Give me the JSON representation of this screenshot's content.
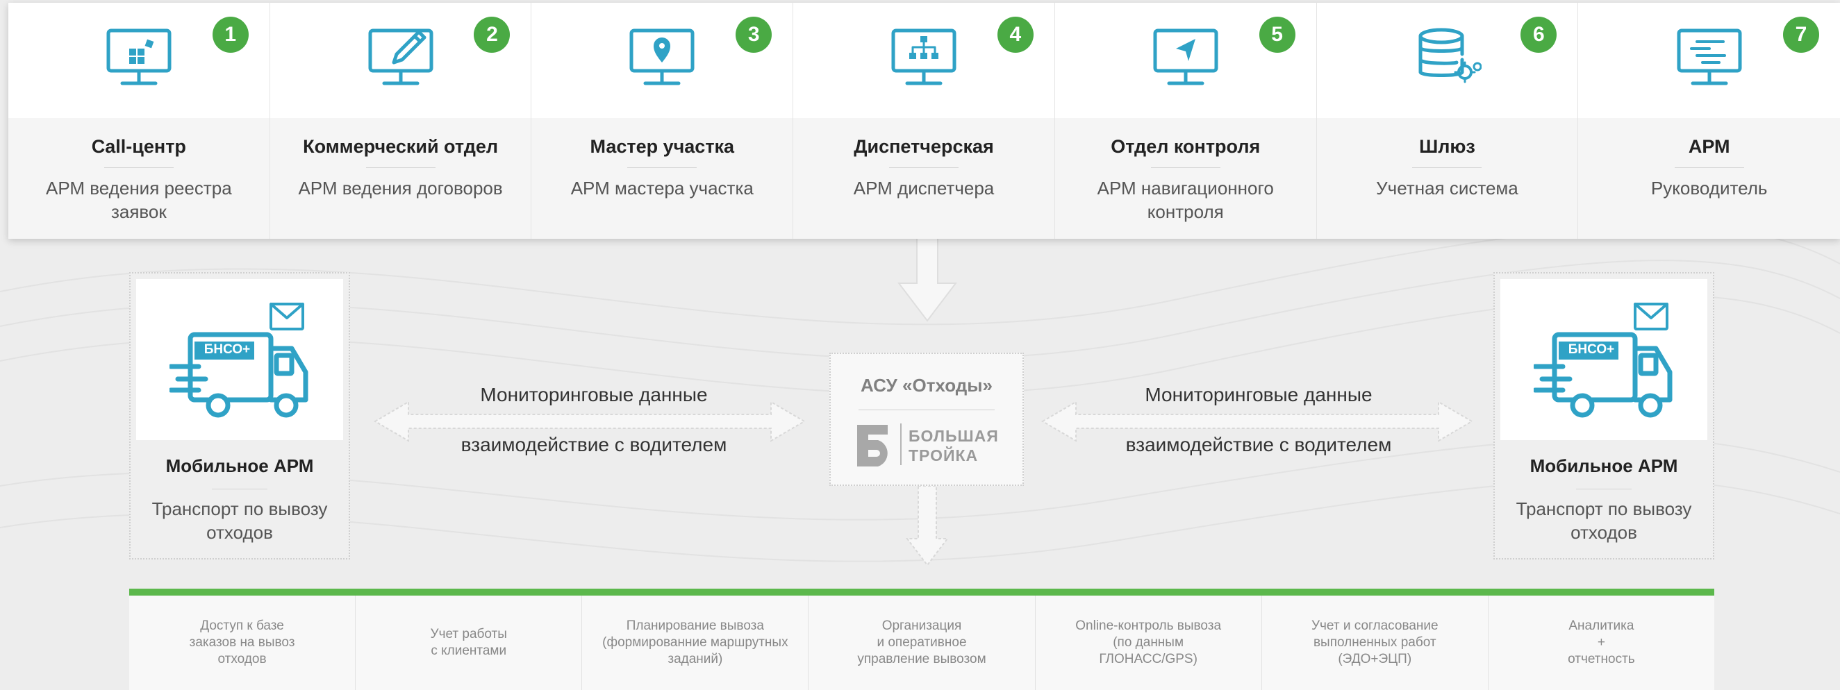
{
  "colors": {
    "accent_blue": "#2fa2c6",
    "badge_green": "#4aaa44",
    "bar_green": "#5cb84c"
  },
  "workstations": [
    {
      "number": "1",
      "title": "Call-центр",
      "desc": "АРМ ведения реестра заявок",
      "icon": "monitor-grid-icon"
    },
    {
      "number": "2",
      "title": "Коммерческий отдел",
      "desc": "АРМ ведения договоров",
      "icon": "monitor-pen-icon"
    },
    {
      "number": "3",
      "title": "Мастер участка",
      "desc": "АРМ мастера участка",
      "icon": "monitor-pin-icon"
    },
    {
      "number": "4",
      "title": "Диспетчерская",
      "desc": "АРМ диспетчера",
      "icon": "monitor-hierarchy-icon"
    },
    {
      "number": "5",
      "title": "Отдел контроля",
      "desc": "АРМ навигационного контроля",
      "icon": "monitor-navigation-icon"
    },
    {
      "number": "6",
      "title": "Шлюз",
      "desc": "Учетная система",
      "icon": "database-gear-icon"
    },
    {
      "number": "7",
      "title": "АРМ",
      "desc": "Руководитель",
      "icon": "monitor-text-icon"
    }
  ],
  "mobile_left": {
    "badge": "БНСО+",
    "title": "Мобильное АРМ",
    "desc": "Транспорт по вывозу отходов"
  },
  "mobile_right": {
    "badge": "БНСО+",
    "title": "Мобильное АРМ",
    "desc": "Транспорт по вывозу отходов"
  },
  "left_link": {
    "top_label": "Мониторинговые данные",
    "bottom_label": "взаимодействие с водителем"
  },
  "right_link": {
    "top_label": "Мониторинговые данные",
    "bottom_label": "взаимодействие с водителем"
  },
  "center": {
    "title": "АСУ «Отходы»",
    "logo_line1": "БОЛЬШАЯ",
    "logo_line2": "ТРОЙКА"
  },
  "functions": [
    "Доступ к базе\nзаказов на вывоз\nотходов",
    "Учет работы\nс клиентами",
    "Планирование вывоза\n(формированние маршрутных\nзаданий)",
    "Организация\nи оперативное\nуправление вывозом",
    "Online-контроль вывоза\n(по данным\nГЛОНАСС/GPS)",
    "Учет и согласование\nвыполненных работ\n(ЭДО+ЭЦП)",
    "Аналитика\n+\nотчетность"
  ]
}
